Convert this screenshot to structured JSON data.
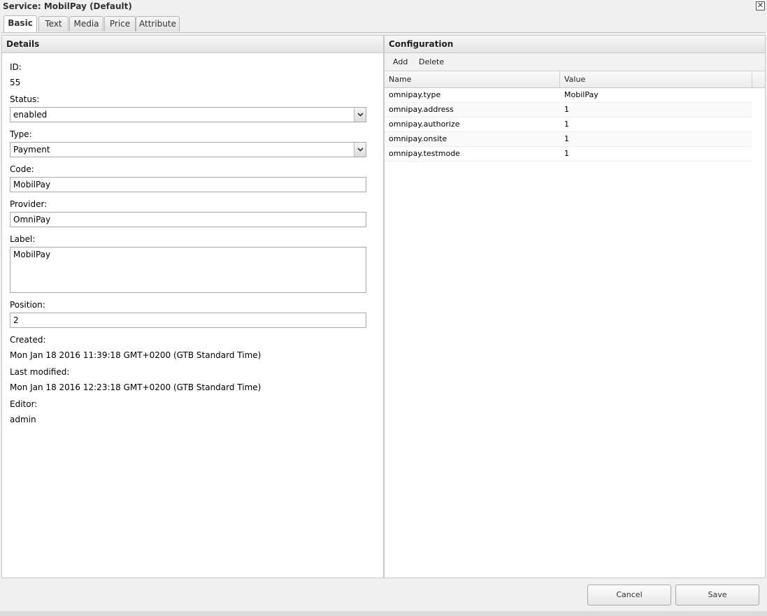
{
  "window": {
    "title": "Service: MobilPay (Default)"
  },
  "tabs": [
    {
      "label": "Basic"
    },
    {
      "label": "Text"
    },
    {
      "label": "Media"
    },
    {
      "label": "Price"
    },
    {
      "label": "Attribute"
    }
  ],
  "details": {
    "header": "Details",
    "id_label": "ID:",
    "id_value": "55",
    "status_label": "Status:",
    "status_value": "enabled",
    "type_label": "Type:",
    "type_value": "Payment",
    "code_label": "Code:",
    "code_value": "MobilPay",
    "provider_label": "Provider:",
    "provider_value": "OmniPay",
    "label_label": "Label:",
    "label_value": "MobilPay",
    "position_label": "Position:",
    "position_value": "2",
    "created_label": "Created:",
    "created_value": "Mon Jan 18 2016 11:39:18 GMT+0200 (GTB Standard Time)",
    "modified_label": "Last modified:",
    "modified_value": "Mon Jan 18 2016 12:23:18 GMT+0200 (GTB Standard Time)",
    "editor_label": "Editor:",
    "editor_value": "admin"
  },
  "configuration": {
    "header": "Configuration",
    "add_label": "Add",
    "delete_label": "Delete",
    "columns": {
      "name": "Name",
      "value": "Value"
    },
    "rows": [
      {
        "name": "omnipay.type",
        "value": "MobilPay"
      },
      {
        "name": "omnipay.address",
        "value": "1"
      },
      {
        "name": "omnipay.authorize",
        "value": "1"
      },
      {
        "name": "omnipay.onsite",
        "value": "1"
      },
      {
        "name": "omnipay.testmode",
        "value": "1"
      }
    ]
  },
  "footer": {
    "cancel_label": "Cancel",
    "save_label": "Save"
  }
}
